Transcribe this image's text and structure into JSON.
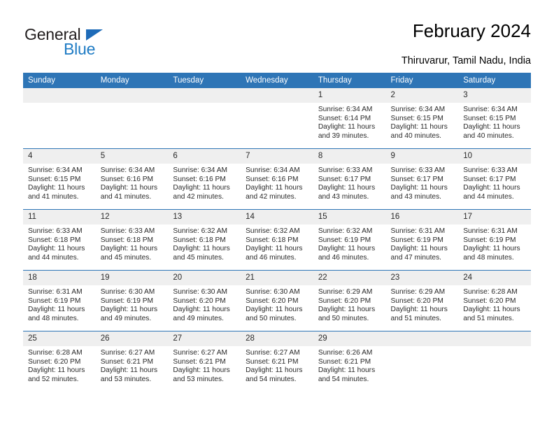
{
  "brand": {
    "word_one": "General",
    "word_two": "Blue",
    "triangle_icon": "triangle-icon",
    "color_dark": "#231f20",
    "color_blue": "#1e7bc4"
  },
  "header": {
    "title": "February 2024",
    "location": "Thiruvarur, Tamil Nadu, India"
  },
  "theme": {
    "header_blue": "#2e75b6",
    "row_band_gray": "#efefef",
    "text": "#2a2a2a"
  },
  "weekdays": [
    "Sunday",
    "Monday",
    "Tuesday",
    "Wednesday",
    "Thursday",
    "Friday",
    "Saturday"
  ],
  "labels": {
    "sunrise": "Sunrise:",
    "sunset": "Sunset:",
    "daylight": "Daylight:"
  },
  "weeks": [
    [
      {
        "day": "",
        "empty": true
      },
      {
        "day": "",
        "empty": true
      },
      {
        "day": "",
        "empty": true
      },
      {
        "day": "",
        "empty": true
      },
      {
        "day": "1",
        "sunrise": "Sunrise: 6:34 AM",
        "sunset": "Sunset: 6:14 PM",
        "daylight_1": "Daylight: 11 hours",
        "daylight_2": "and 39 minutes."
      },
      {
        "day": "2",
        "sunrise": "Sunrise: 6:34 AM",
        "sunset": "Sunset: 6:15 PM",
        "daylight_1": "Daylight: 11 hours",
        "daylight_2": "and 40 minutes."
      },
      {
        "day": "3",
        "sunrise": "Sunrise: 6:34 AM",
        "sunset": "Sunset: 6:15 PM",
        "daylight_1": "Daylight: 11 hours",
        "daylight_2": "and 40 minutes."
      }
    ],
    [
      {
        "day": "4",
        "sunrise": "Sunrise: 6:34 AM",
        "sunset": "Sunset: 6:15 PM",
        "daylight_1": "Daylight: 11 hours",
        "daylight_2": "and 41 minutes."
      },
      {
        "day": "5",
        "sunrise": "Sunrise: 6:34 AM",
        "sunset": "Sunset: 6:16 PM",
        "daylight_1": "Daylight: 11 hours",
        "daylight_2": "and 41 minutes."
      },
      {
        "day": "6",
        "sunrise": "Sunrise: 6:34 AM",
        "sunset": "Sunset: 6:16 PM",
        "daylight_1": "Daylight: 11 hours",
        "daylight_2": "and 42 minutes."
      },
      {
        "day": "7",
        "sunrise": "Sunrise: 6:34 AM",
        "sunset": "Sunset: 6:16 PM",
        "daylight_1": "Daylight: 11 hours",
        "daylight_2": "and 42 minutes."
      },
      {
        "day": "8",
        "sunrise": "Sunrise: 6:33 AM",
        "sunset": "Sunset: 6:17 PM",
        "daylight_1": "Daylight: 11 hours",
        "daylight_2": "and 43 minutes."
      },
      {
        "day": "9",
        "sunrise": "Sunrise: 6:33 AM",
        "sunset": "Sunset: 6:17 PM",
        "daylight_1": "Daylight: 11 hours",
        "daylight_2": "and 43 minutes."
      },
      {
        "day": "10",
        "sunrise": "Sunrise: 6:33 AM",
        "sunset": "Sunset: 6:17 PM",
        "daylight_1": "Daylight: 11 hours",
        "daylight_2": "and 44 minutes."
      }
    ],
    [
      {
        "day": "11",
        "sunrise": "Sunrise: 6:33 AM",
        "sunset": "Sunset: 6:18 PM",
        "daylight_1": "Daylight: 11 hours",
        "daylight_2": "and 44 minutes."
      },
      {
        "day": "12",
        "sunrise": "Sunrise: 6:33 AM",
        "sunset": "Sunset: 6:18 PM",
        "daylight_1": "Daylight: 11 hours",
        "daylight_2": "and 45 minutes."
      },
      {
        "day": "13",
        "sunrise": "Sunrise: 6:32 AM",
        "sunset": "Sunset: 6:18 PM",
        "daylight_1": "Daylight: 11 hours",
        "daylight_2": "and 45 minutes."
      },
      {
        "day": "14",
        "sunrise": "Sunrise: 6:32 AM",
        "sunset": "Sunset: 6:18 PM",
        "daylight_1": "Daylight: 11 hours",
        "daylight_2": "and 46 minutes."
      },
      {
        "day": "15",
        "sunrise": "Sunrise: 6:32 AM",
        "sunset": "Sunset: 6:19 PM",
        "daylight_1": "Daylight: 11 hours",
        "daylight_2": "and 46 minutes."
      },
      {
        "day": "16",
        "sunrise": "Sunrise: 6:31 AM",
        "sunset": "Sunset: 6:19 PM",
        "daylight_1": "Daylight: 11 hours",
        "daylight_2": "and 47 minutes."
      },
      {
        "day": "17",
        "sunrise": "Sunrise: 6:31 AM",
        "sunset": "Sunset: 6:19 PM",
        "daylight_1": "Daylight: 11 hours",
        "daylight_2": "and 48 minutes."
      }
    ],
    [
      {
        "day": "18",
        "sunrise": "Sunrise: 6:31 AM",
        "sunset": "Sunset: 6:19 PM",
        "daylight_1": "Daylight: 11 hours",
        "daylight_2": "and 48 minutes."
      },
      {
        "day": "19",
        "sunrise": "Sunrise: 6:30 AM",
        "sunset": "Sunset: 6:19 PM",
        "daylight_1": "Daylight: 11 hours",
        "daylight_2": "and 49 minutes."
      },
      {
        "day": "20",
        "sunrise": "Sunrise: 6:30 AM",
        "sunset": "Sunset: 6:20 PM",
        "daylight_1": "Daylight: 11 hours",
        "daylight_2": "and 49 minutes."
      },
      {
        "day": "21",
        "sunrise": "Sunrise: 6:30 AM",
        "sunset": "Sunset: 6:20 PM",
        "daylight_1": "Daylight: 11 hours",
        "daylight_2": "and 50 minutes."
      },
      {
        "day": "22",
        "sunrise": "Sunrise: 6:29 AM",
        "sunset": "Sunset: 6:20 PM",
        "daylight_1": "Daylight: 11 hours",
        "daylight_2": "and 50 minutes."
      },
      {
        "day": "23",
        "sunrise": "Sunrise: 6:29 AM",
        "sunset": "Sunset: 6:20 PM",
        "daylight_1": "Daylight: 11 hours",
        "daylight_2": "and 51 minutes."
      },
      {
        "day": "24",
        "sunrise": "Sunrise: 6:28 AM",
        "sunset": "Sunset: 6:20 PM",
        "daylight_1": "Daylight: 11 hours",
        "daylight_2": "and 51 minutes."
      }
    ],
    [
      {
        "day": "25",
        "sunrise": "Sunrise: 6:28 AM",
        "sunset": "Sunset: 6:20 PM",
        "daylight_1": "Daylight: 11 hours",
        "daylight_2": "and 52 minutes."
      },
      {
        "day": "26",
        "sunrise": "Sunrise: 6:27 AM",
        "sunset": "Sunset: 6:21 PM",
        "daylight_1": "Daylight: 11 hours",
        "daylight_2": "and 53 minutes."
      },
      {
        "day": "27",
        "sunrise": "Sunrise: 6:27 AM",
        "sunset": "Sunset: 6:21 PM",
        "daylight_1": "Daylight: 11 hours",
        "daylight_2": "and 53 minutes."
      },
      {
        "day": "28",
        "sunrise": "Sunrise: 6:27 AM",
        "sunset": "Sunset: 6:21 PM",
        "daylight_1": "Daylight: 11 hours",
        "daylight_2": "and 54 minutes."
      },
      {
        "day": "29",
        "sunrise": "Sunrise: 6:26 AM",
        "sunset": "Sunset: 6:21 PM",
        "daylight_1": "Daylight: 11 hours",
        "daylight_2": "and 54 minutes."
      },
      {
        "day": "",
        "empty": true
      },
      {
        "day": "",
        "empty": true
      }
    ]
  ]
}
